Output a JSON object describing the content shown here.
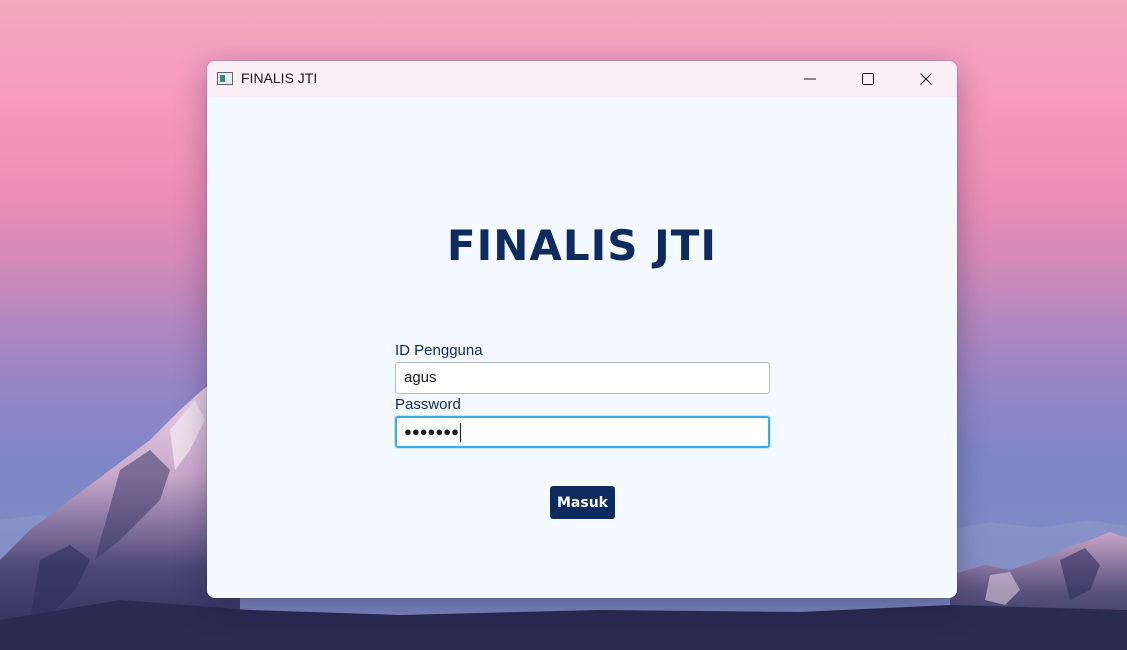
{
  "window": {
    "title": "FINALIS JTI"
  },
  "login": {
    "heading": "FINALIS JTI",
    "user_label": "ID Pengguna",
    "user_value": "agus",
    "password_label": "Password",
    "password_mask": "●●●●●●●",
    "submit_label": "Masuk"
  },
  "icons": {
    "app": "app-window-icon",
    "minimize": "minimize-icon",
    "maximize": "maximize-icon",
    "close": "close-icon"
  },
  "colors": {
    "primary": "#0d2b5e",
    "focus": "#33aee8",
    "surface": "#f4f8ff",
    "titlebar": "#f9eff4"
  }
}
